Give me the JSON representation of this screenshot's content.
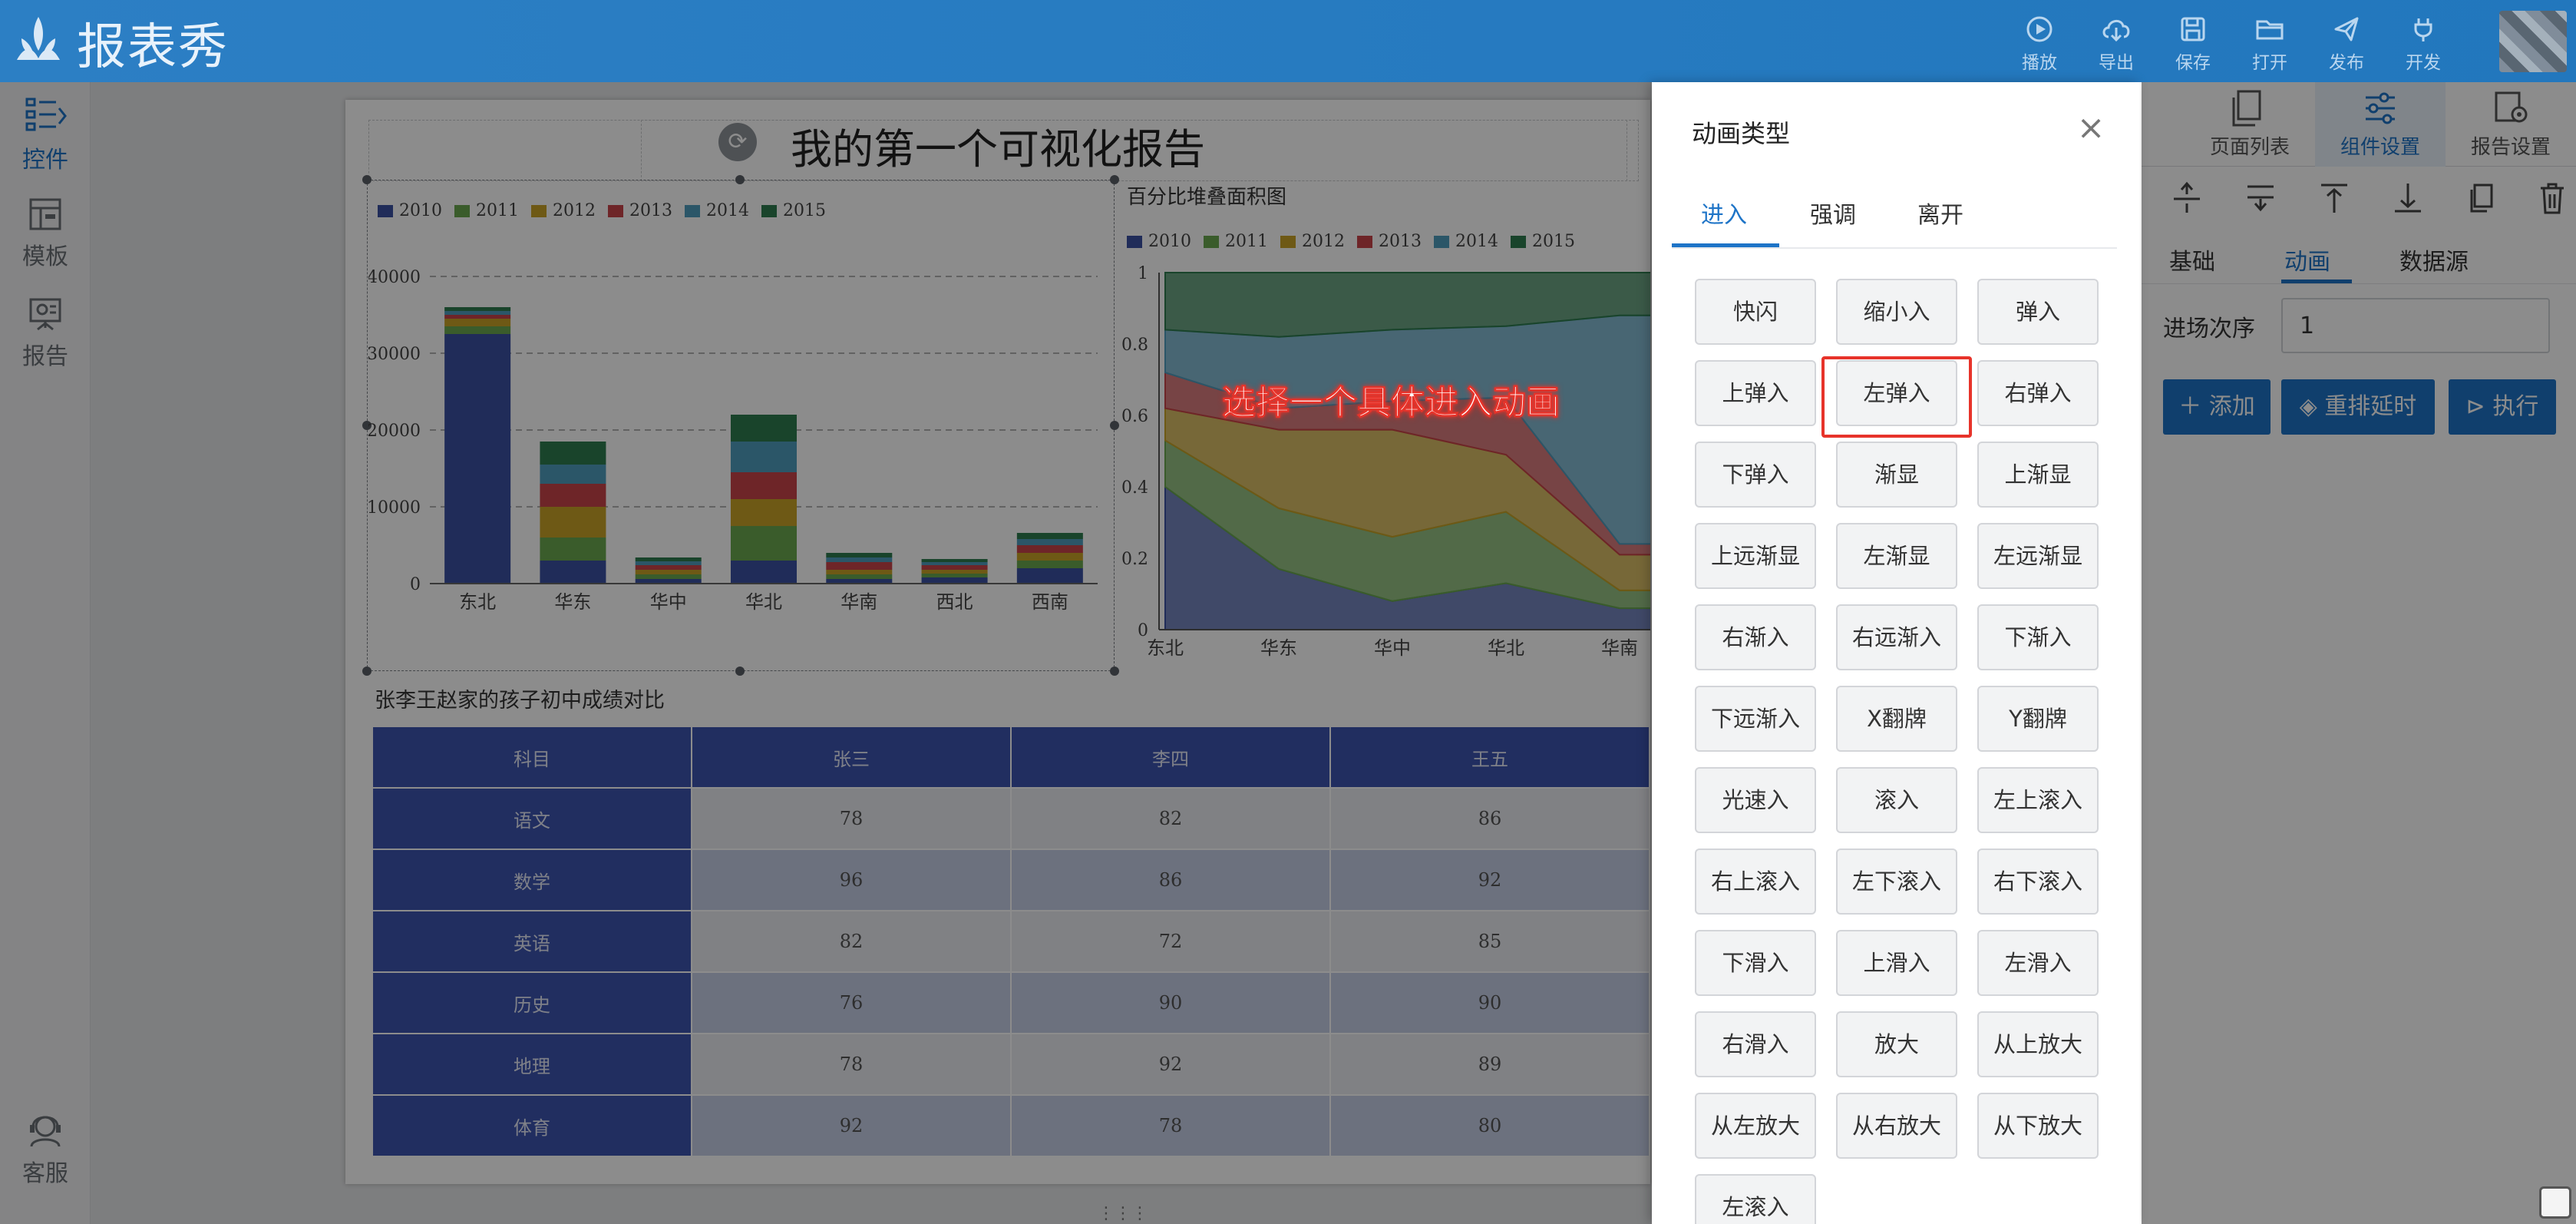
{
  "app": {
    "title": "报表秀"
  },
  "toolbar": [
    {
      "name": "play",
      "label": "播放"
    },
    {
      "name": "export",
      "label": "导出"
    },
    {
      "name": "save",
      "label": "保存"
    },
    {
      "name": "open",
      "label": "打开"
    },
    {
      "name": "publish",
      "label": "发布"
    },
    {
      "name": "develop",
      "label": "开发"
    }
  ],
  "sidebar": [
    {
      "label": "控件",
      "icon": "widget-icon"
    },
    {
      "label": "模板",
      "icon": "template-icon"
    },
    {
      "label": "报告",
      "icon": "report-icon"
    },
    {
      "label": "客服",
      "icon": "support-icon"
    }
  ],
  "report": {
    "title": "我的第一个可视化报告",
    "table_title": "张李王赵家的孩子初中成绩对比"
  },
  "chart_data": [
    {
      "type": "bar",
      "stacked": true,
      "categories": [
        "东北",
        "华东",
        "华中",
        "华北",
        "华南",
        "西北",
        "西南"
      ],
      "ylim": [
        0,
        40000
      ],
      "yticks": [
        0,
        10000,
        20000,
        30000,
        40000
      ],
      "legend_position": "top-left",
      "series": [
        {
          "name": "2010",
          "color": "#3b51a3",
          "values": [
            32500,
            3000,
            600,
            3000,
            600,
            800,
            2000
          ]
        },
        {
          "name": "2011",
          "color": "#6aa84f",
          "values": [
            1000,
            3000,
            600,
            4500,
            600,
            500,
            1000
          ]
        },
        {
          "name": "2012",
          "color": "#c9a227",
          "values": [
            1000,
            4000,
            600,
            3500,
            600,
            500,
            1000
          ]
        },
        {
          "name": "2013",
          "color": "#c94449",
          "values": [
            500,
            3000,
            600,
            3500,
            1000,
            600,
            1000
          ]
        },
        {
          "name": "2014",
          "color": "#4f9dbd",
          "values": [
            500,
            2500,
            500,
            4000,
            600,
            400,
            800
          ]
        },
        {
          "name": "2015",
          "color": "#2e7d4f",
          "values": [
            500,
            3000,
            500,
            3500,
            600,
            400,
            800
          ]
        }
      ]
    },
    {
      "type": "area",
      "stacked": true,
      "percent": true,
      "title": "百分比堆叠面积图",
      "categories": [
        "东北",
        "华东",
        "华中",
        "华北",
        "华南"
      ],
      "ylim": [
        0,
        1
      ],
      "yticks": [
        0,
        0.2,
        0.4,
        0.6,
        0.8,
        1
      ],
      "legend_position": "top-left",
      "series": [
        {
          "name": "2010",
          "color": "#3b51a3",
          "values": [
            0.4,
            0.17,
            0.08,
            0.13,
            0.06
          ]
        },
        {
          "name": "2011",
          "color": "#6aa84f",
          "values": [
            0.13,
            0.17,
            0.18,
            0.2,
            0.05
          ]
        },
        {
          "name": "2012",
          "color": "#c9a227",
          "values": [
            0.09,
            0.22,
            0.3,
            0.16,
            0.1
          ]
        },
        {
          "name": "2013",
          "color": "#c94449",
          "values": [
            0.1,
            0.06,
            0.08,
            0.16,
            0.03
          ]
        },
        {
          "name": "2014",
          "color": "#4f9dbd",
          "values": [
            0.12,
            0.2,
            0.2,
            0.2,
            0.64
          ]
        },
        {
          "name": "2015",
          "color": "#2e7d4f",
          "values": [
            0.16,
            0.18,
            0.16,
            0.15,
            0.12
          ]
        }
      ]
    },
    {
      "type": "table",
      "headers": [
        "科目",
        "张三",
        "李四",
        "王五"
      ],
      "rows": [
        [
          "语文",
          "78",
          "82",
          "86"
        ],
        [
          "数学",
          "96",
          "86",
          "92"
        ],
        [
          "英语",
          "82",
          "72",
          "85"
        ],
        [
          "历史",
          "76",
          "90",
          "90"
        ],
        [
          "地理",
          "78",
          "92",
          "89"
        ],
        [
          "体育",
          "92",
          "78",
          "80"
        ]
      ]
    }
  ],
  "right_panel": {
    "tabs": [
      "页面列表",
      "组件设置",
      "报告设置"
    ],
    "subtabs": [
      "基础",
      "动画",
      "数据源"
    ],
    "sequence_label": "进场次序",
    "sequence_value": "1",
    "buttons": [
      "添加",
      "重排延时",
      "执行"
    ]
  },
  "modal": {
    "title": "动画类型",
    "tabs": [
      "进入",
      "强调",
      "离开"
    ],
    "animations": [
      "快闪",
      "缩小入",
      "弹入",
      "上弹入",
      "左弹入",
      "右弹入",
      "下弹入",
      "渐显",
      "上渐显",
      "上远渐显",
      "左渐显",
      "左远渐显",
      "右渐入",
      "右远渐入",
      "下渐入",
      "下远渐入",
      "X翻牌",
      "Y翻牌",
      "光速入",
      "滚入",
      "左上滚入",
      "右上滚入",
      "左下滚入",
      "右下滚入",
      "下滑入",
      "上滑入",
      "左滑入",
      "右滑入",
      "放大",
      "从上放大",
      "从左放大",
      "从右放大",
      "从下放大",
      "左滚入"
    ],
    "selected": "左弹入"
  },
  "annotation": {
    "callout": "选择一个具体进入动画",
    "color": "#e7332a"
  },
  "colors": {
    "accent": "#1e74c7",
    "topbar": "#2277bd",
    "table_header": "#3d55b0"
  }
}
